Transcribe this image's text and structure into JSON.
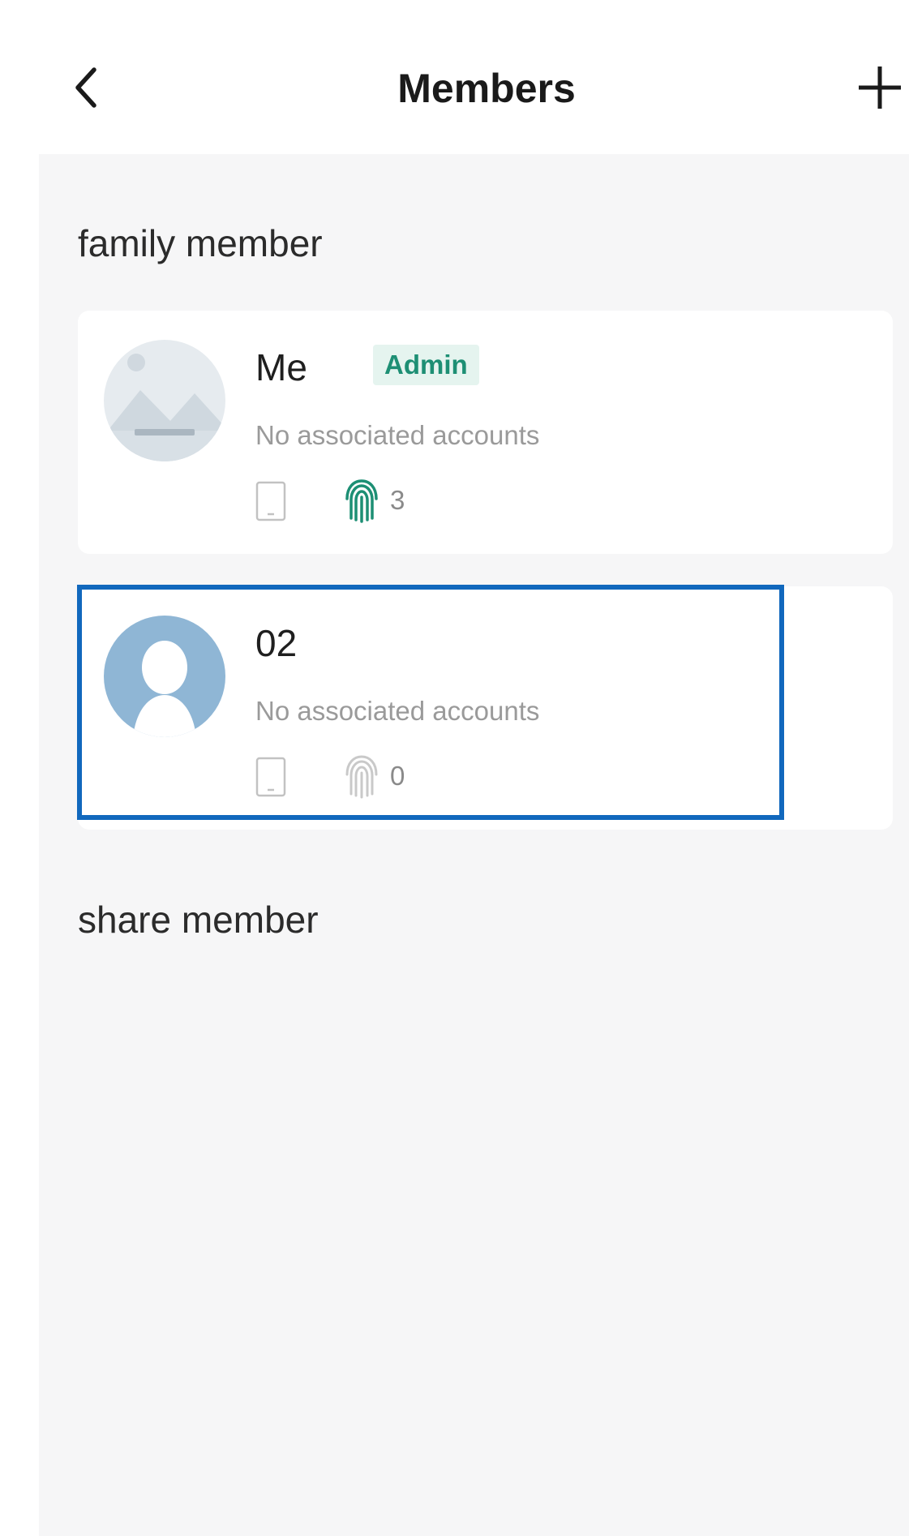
{
  "header": {
    "title": "Members",
    "back_icon": "chevron-left-icon",
    "add_icon": "plus-icon"
  },
  "sections": {
    "family": {
      "title": "family member"
    },
    "share": {
      "title": "share member"
    }
  },
  "members": [
    {
      "name": "Me",
      "badge": "Admin",
      "subtitle": "No associated accounts",
      "fingerprint_count": "3",
      "avatar": "landscape-placeholder-avatar"
    },
    {
      "name": "02",
      "subtitle": "No associated accounts",
      "fingerprint_count": "0",
      "avatar": "person-silhouette-avatar"
    }
  ],
  "colors": {
    "accent": "#1d8f74",
    "badge_bg": "#e5f4ef",
    "highlight": "#1168bd",
    "background": "#f6f6f7"
  }
}
